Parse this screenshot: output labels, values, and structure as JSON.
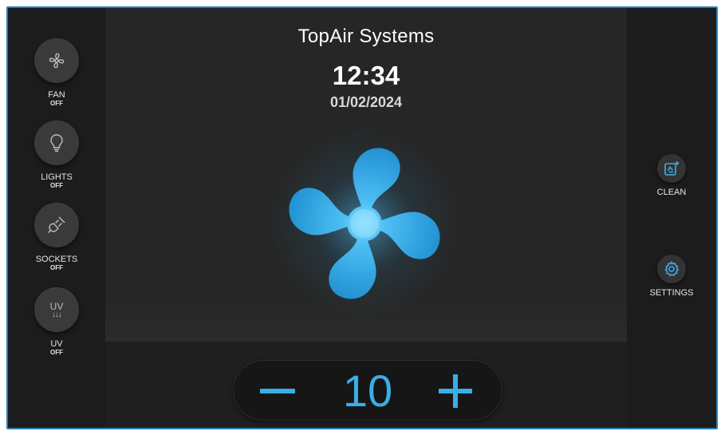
{
  "header": {
    "brand": "TopAir Systems",
    "time": "12:34",
    "date": "01/02/2024"
  },
  "left_controls": [
    {
      "label": "FAN",
      "state": "OFF",
      "icon": "fan-icon"
    },
    {
      "label": "LIGHTS",
      "state": "OFF",
      "icon": "lightbulb-icon"
    },
    {
      "label": "SOCKETS",
      "state": "OFF",
      "icon": "plug-icon"
    },
    {
      "label": "UV",
      "state": "OFF",
      "icon": "uv-icon",
      "icon_text": "UV",
      "icon_arrows": "↓↓↓"
    }
  ],
  "right_controls": [
    {
      "label": "CLEAN",
      "icon": "clean-icon"
    },
    {
      "label": "SETTINGS",
      "icon": "gear-icon"
    }
  ],
  "speed": {
    "value": "10",
    "decrease_icon": "minus-icon",
    "increase_icon": "plus-icon"
  },
  "colors": {
    "accent": "#3aaee8",
    "frame": "#2a7fb8",
    "background": "#242424",
    "panel": "#1c1c1c"
  },
  "main_graphic": "fan-blade-graphic"
}
